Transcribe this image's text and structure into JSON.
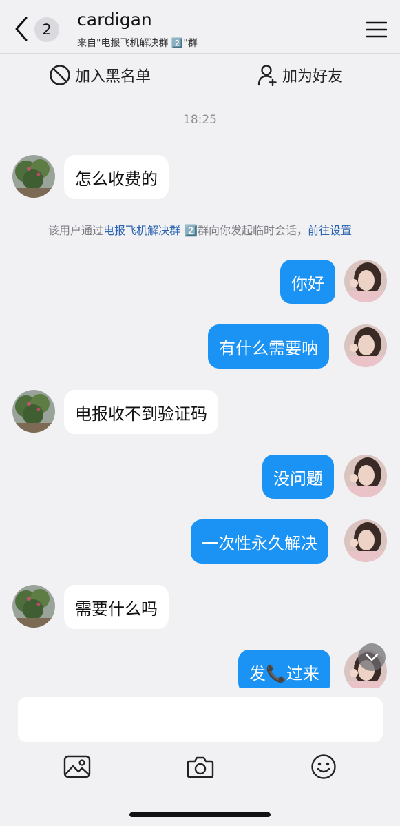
{
  "header": {
    "unread_count": "2",
    "title": "cardigan",
    "subtitle": "来自\"电报飞机解决群 2️⃣\"群"
  },
  "actions": {
    "block_label": "加入黑名单",
    "add_friend_label": "加为好友"
  },
  "chat": {
    "time": "18:25",
    "notice_prefix": "该用户通过",
    "notice_group": "电报飞机解决群 2️⃣",
    "notice_middle": "群向你发起临时会话，",
    "notice_link": "前往设置",
    "messages": [
      {
        "side": "in",
        "text": "怎么收费的"
      },
      {
        "side": "out",
        "text": "你好"
      },
      {
        "side": "out",
        "text": "有什么需要呐"
      },
      {
        "side": "in",
        "text": "电报收不到验证码"
      },
      {
        "side": "out",
        "text": "没问题"
      },
      {
        "side": "out",
        "text": "一次性永久解决"
      },
      {
        "side": "in",
        "text": "需要什么吗"
      },
      {
        "side": "out",
        "text": "发📞过来"
      }
    ]
  },
  "input": {
    "placeholder": ""
  },
  "icons": {
    "back": "chevron-left-icon",
    "menu": "hamburger-menu-icon",
    "block": "prohibited-icon",
    "add_friend": "person-add-icon",
    "scroll_down": "chevron-down-icon",
    "image": "image-icon",
    "camera": "camera-icon",
    "emoji": "smiley-icon"
  },
  "colors": {
    "outgoing_bubble": "#1a93f5",
    "incoming_bubble": "#ffffff",
    "link": "#2a63b0",
    "background": "#f1f1f4"
  }
}
